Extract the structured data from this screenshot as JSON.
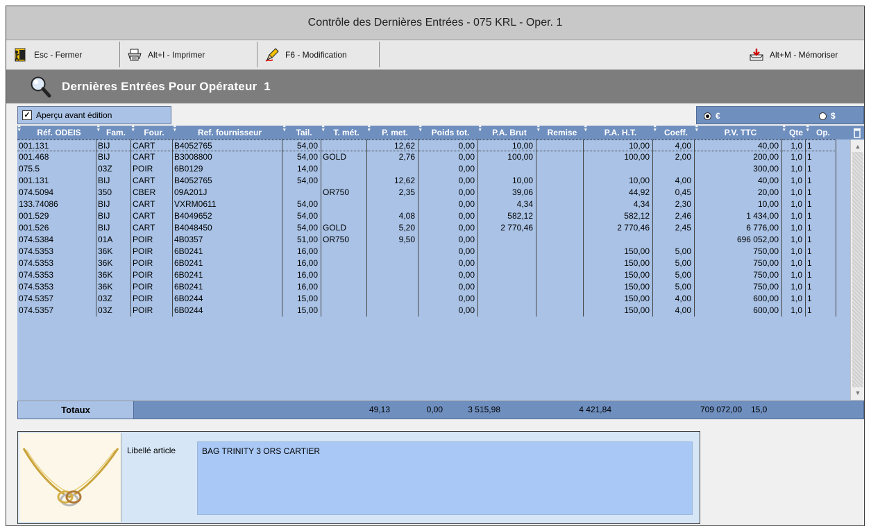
{
  "window": {
    "title": "Contrôle des Dernières Entrées - 075 KRL - Oper. 1"
  },
  "toolbar": {
    "close_label": "Esc - Fermer",
    "print_label": "Alt+I - Imprimer",
    "modify_label": "F6 - Modification",
    "memorize_label": "Alt+M - Mémoriser"
  },
  "header": {
    "title": "Dernières Entrées Pour Opérateur",
    "operator": "1"
  },
  "options": {
    "apercu_label": "Aperçu avant édition",
    "apercu_checked": true,
    "currency_euro": "€",
    "currency_dollar": "$",
    "currency_selected": "€"
  },
  "grid": {
    "columns": [
      "Réf. ODEIS",
      "Fam.",
      "Four.",
      "Ref. fournisseur",
      "Tail.",
      "T. mét.",
      "P. met.",
      "Poids tot.",
      "P.A. Brut",
      "Remise",
      "P.A. H.T.",
      "Coeff.",
      "P.V. TTC",
      "Qte",
      "Op."
    ],
    "rows": [
      [
        "001.131",
        "BIJ",
        "CART",
        "B4052765",
        "54,00",
        "",
        "12,62",
        "0,00",
        "10,00",
        "",
        "10,00",
        "4,00",
        "40,00",
        "1,0",
        "1"
      ],
      [
        "001.468",
        "BIJ",
        "CART",
        "B3008800",
        "54,00",
        "GOLD",
        "2,76",
        "0,00",
        "100,00",
        "",
        "100,00",
        "2,00",
        "200,00",
        "1,0",
        "1"
      ],
      [
        "075.5",
        "03Z",
        "POIR",
        "6B0129",
        "14,00",
        "",
        "",
        "0,00",
        "",
        "",
        "",
        "",
        "300,00",
        "1,0",
        "1"
      ],
      [
        "001.131",
        "BIJ",
        "CART",
        "B4052765",
        "54,00",
        "",
        "12,62",
        "0,00",
        "10,00",
        "",
        "10,00",
        "4,00",
        "40,00",
        "1,0",
        "1"
      ],
      [
        "074.5094",
        "350",
        "CBER",
        "09A201J",
        "",
        "OR750",
        "2,35",
        "0,00",
        "39,06",
        "",
        "44,92",
        "0,45",
        "20,00",
        "1,0",
        "1"
      ],
      [
        "133.74086",
        "BIJ",
        "CART",
        "VXRM0611",
        "54,00",
        "",
        "",
        "0,00",
        "4,34",
        "",
        "4,34",
        "2,30",
        "10,00",
        "1,0",
        "1"
      ],
      [
        "001.529",
        "BIJ",
        "CART",
        "B4049652",
        "54,00",
        "",
        "4,08",
        "0,00",
        "582,12",
        "",
        "582,12",
        "2,46",
        "1 434,00",
        "1,0",
        "1"
      ],
      [
        "001.526",
        "BIJ",
        "CART",
        "B4048450",
        "54,00",
        "GOLD",
        "5,20",
        "0,00",
        "2 770,46",
        "",
        "2 770,46",
        "2,45",
        "6 776,00",
        "1,0",
        "1"
      ],
      [
        "074.5384",
        "01A",
        "POIR",
        "4B0357",
        "51,00",
        "OR750",
        "9,50",
        "0,00",
        "",
        "",
        "",
        "",
        "696 052,00",
        "1,0",
        "1"
      ],
      [
        "074.5353",
        "36K",
        "POIR",
        "6B0241",
        "16,00",
        "",
        "",
        "0,00",
        "",
        "",
        "150,00",
        "5,00",
        "750,00",
        "1,0",
        "1"
      ],
      [
        "074.5353",
        "36K",
        "POIR",
        "6B0241",
        "16,00",
        "",
        "",
        "0,00",
        "",
        "",
        "150,00",
        "5,00",
        "750,00",
        "1,0",
        "1"
      ],
      [
        "074.5353",
        "36K",
        "POIR",
        "6B0241",
        "16,00",
        "",
        "",
        "0,00",
        "",
        "",
        "150,00",
        "5,00",
        "750,00",
        "1,0",
        "1"
      ],
      [
        "074.5353",
        "36K",
        "POIR",
        "6B0241",
        "16,00",
        "",
        "",
        "0,00",
        "",
        "",
        "150,00",
        "5,00",
        "750,00",
        "1,0",
        "1"
      ],
      [
        "074.5357",
        "03Z",
        "POIR",
        "6B0244",
        "15,00",
        "",
        "",
        "0,00",
        "",
        "",
        "150,00",
        "4,00",
        "600,00",
        "1,0",
        "1"
      ],
      [
        "074.5357",
        "03Z",
        "POIR",
        "6B0244",
        "15,00",
        "",
        "",
        "0,00",
        "",
        "",
        "150,00",
        "4,00",
        "600,00",
        "1,0",
        "1"
      ]
    ]
  },
  "totals": {
    "label": "Totaux",
    "p_met": "49,13",
    "poids_tot": "0,00",
    "pa_brut": "3 515,98",
    "pa_ht": "4 421,84",
    "pv_ttc": "709 072,00",
    "qte": "15,0"
  },
  "article": {
    "label": "Libellé article",
    "value": "BAG TRINITY 3 ORS CARTIER",
    "image_icon": "necklace-image"
  },
  "colors": {
    "grid_bg": "#a9c2e5",
    "header_bg": "#6f8fbf",
    "band_bg": "#7d7d7d"
  }
}
